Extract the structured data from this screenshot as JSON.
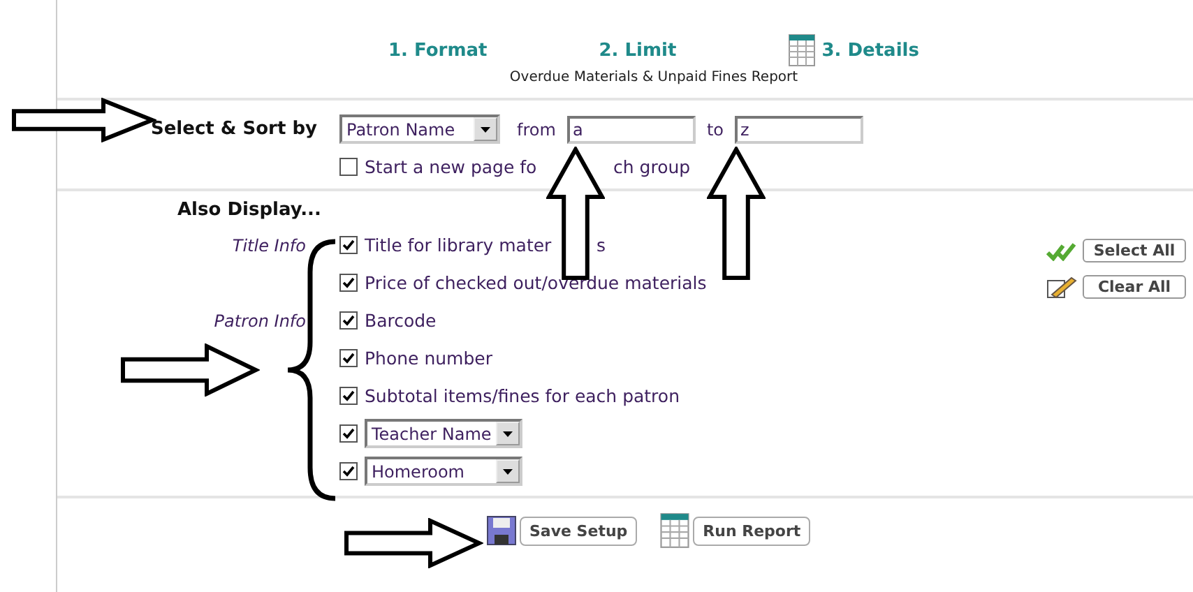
{
  "steps": [
    {
      "label": "1. Format",
      "selected": false
    },
    {
      "label": "2. Limit",
      "selected": false
    },
    {
      "label": "3. Details",
      "selected": true
    }
  ],
  "report_title": "Overdue Materials & Unpaid Fines Report",
  "sort": {
    "label": "Select & Sort by",
    "field": "Patron Name",
    "from_label": "from",
    "from": "a",
    "to_label": "to",
    "to": "z"
  },
  "new_page": {
    "checked": false,
    "label_parts": [
      "Start a new page fo",
      "ch group"
    ]
  },
  "also_display": {
    "heading": "Also Display...",
    "options": [
      {
        "group": "Title Info",
        "kind": "checkbox",
        "checked": true,
        "label_parts": [
          "Title for library mater",
          "s"
        ]
      },
      {
        "kind": "checkbox",
        "checked": true,
        "label_parts": [
          "Price of checked out/overdue materials"
        ]
      },
      {
        "group": "Patron Info",
        "kind": "checkbox",
        "checked": true,
        "label_parts": [
          "Barcode"
        ]
      },
      {
        "kind": "checkbox",
        "checked": true,
        "label_parts": [
          "Phone number"
        ]
      },
      {
        "kind": "checkbox",
        "checked": true,
        "label_parts": [
          "Subtotal items/fines for each patron"
        ]
      },
      {
        "kind": "select",
        "checked": true,
        "value": "Teacher Name"
      },
      {
        "kind": "select",
        "checked": true,
        "value": "Homeroom"
      }
    ]
  },
  "select_all": "Select All",
  "clear_all": "Clear All",
  "buttons": [
    {
      "kind": "save",
      "label": "Save Setup"
    },
    {
      "kind": "run",
      "label": "Run Report"
    }
  ]
}
